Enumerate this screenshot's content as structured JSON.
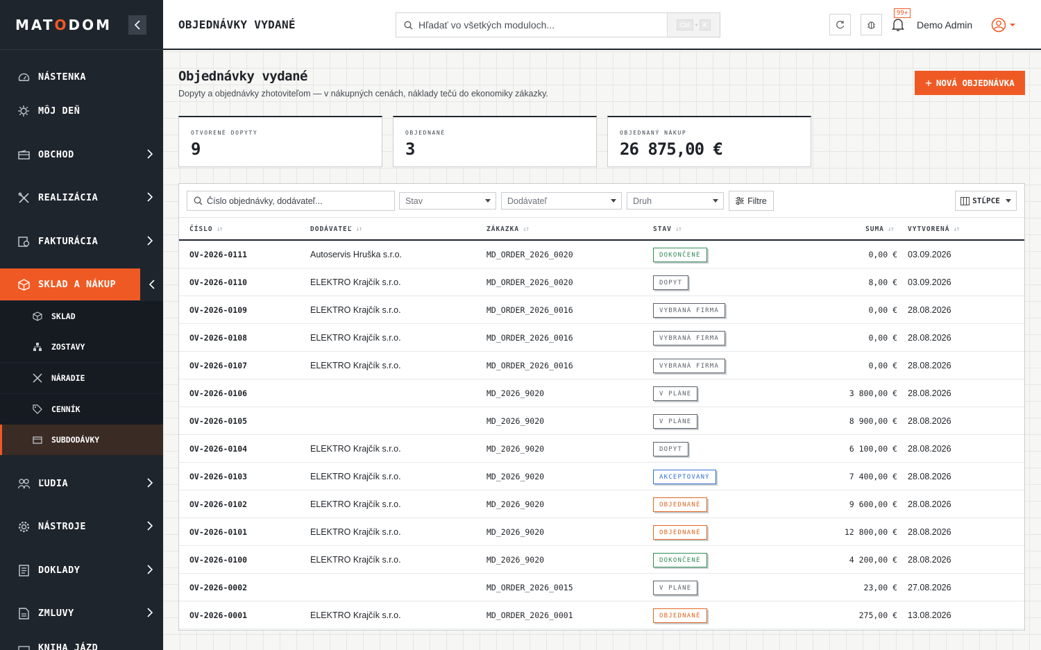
{
  "brand": {
    "logo_part1": "MAT",
    "logo_accent": "O",
    "logo_part2": "DOM",
    "accent_color": "#ef5a24"
  },
  "sidebar": {
    "items": [
      {
        "label": "NÁSTENKA",
        "icon": "gauge-icon"
      },
      {
        "label": "MÔJ DEŇ",
        "icon": "sun-icon"
      },
      {
        "label": "OBCHOD",
        "icon": "wallet-icon"
      },
      {
        "label": "REALIZÁCIA",
        "icon": "tools-icon"
      },
      {
        "label": "FAKTURÁCIA",
        "icon": "invoice-icon"
      },
      {
        "label": "SKLAD A NÁKUP",
        "icon": "box-icon"
      },
      {
        "label": "ĽUDIA",
        "icon": "people-icon"
      },
      {
        "label": "NÁSTROJE",
        "icon": "gear-icon"
      },
      {
        "label": "DOKLADY",
        "icon": "document-icon"
      },
      {
        "label": "ZMLUVY",
        "icon": "contract-icon"
      },
      {
        "label": "KNIHA JÁZD",
        "icon": "car-icon"
      }
    ],
    "subitems": [
      {
        "label": "SKLAD",
        "icon": "box-icon"
      },
      {
        "label": "ZOSTAVY",
        "icon": "hierarchy-icon"
      },
      {
        "label": "NÁRADIE",
        "icon": "tools-icon"
      },
      {
        "label": "CENNÍK",
        "icon": "tag-icon"
      },
      {
        "label": "SUBDODÁVKY",
        "icon": "package-icon"
      }
    ]
  },
  "header": {
    "title": "OBJEDNÁVKY VYDANÉ",
    "search_placeholder": "Hľadať vo všetkých moduloch...",
    "shortcut_key1": "Ctrl",
    "shortcut_key2": "K",
    "notifications_badge": "99+",
    "user_name": "Demo Admin"
  },
  "page": {
    "title": "Objednávky vydané",
    "subtitle": "Dopyty a objednávky zhotoviteľom — v nákupných cenách, náklady tečú do ekonomiky zákazky.",
    "new_button": "NOVÁ OBJEDNÁVKA"
  },
  "stats": [
    {
      "label": "OTVORENÉ DOPYTY",
      "value": "9"
    },
    {
      "label": "OBJEDNANÉ",
      "value": "3"
    },
    {
      "label": "OBJEDNANÝ NÁKUP",
      "value": "26 875,00 €"
    }
  ],
  "filters": {
    "search_placeholder": "Číslo objednávky, dodávateľ...",
    "status_placeholder": "Stav",
    "supplier_placeholder": "Dodávateľ",
    "type_placeholder": "Druh",
    "filters_button": "Filtre",
    "columns_button": "STĹPCE"
  },
  "table": {
    "columns": [
      "ČÍSLO",
      "DODÁVATEĽ",
      "ZÁKAZKA",
      "STAV",
      "SUMA",
      "VYTVORENÁ"
    ],
    "rows": [
      {
        "number": "OV-2026-0111",
        "supplier": "Autoservis Hruška s.r.o.",
        "order": "MD_ORDER_2026_0020",
        "status": "DOKONČENÉ",
        "status_color": "#2e8b57",
        "sum": "0,00 €",
        "created": "03.09.2026"
      },
      {
        "number": "OV-2026-0110",
        "supplier": "ELEKTRO Krajčík s.r.o.",
        "order": "MD_ORDER_2026_0020",
        "status": "DOPYT",
        "status_color": "#5b6169",
        "sum": "8,00 €",
        "created": "03.09.2026"
      },
      {
        "number": "OV-2026-0109",
        "supplier": "ELEKTRO Krajčík s.r.o.",
        "order": "MD_ORDER_2026_0016",
        "status": "VYBRANÁ FIRMA",
        "status_color": "#5b6169",
        "sum": "0,00 €",
        "created": "28.08.2026"
      },
      {
        "number": "OV-2026-0108",
        "supplier": "ELEKTRO Krajčík s.r.o.",
        "order": "MD_ORDER_2026_0016",
        "status": "VYBRANÁ FIRMA",
        "status_color": "#5b6169",
        "sum": "0,00 €",
        "created": "28.08.2026"
      },
      {
        "number": "OV-2026-0107",
        "supplier": "ELEKTRO Krajčík s.r.o.",
        "order": "MD_ORDER_2026_0016",
        "status": "VYBRANÁ FIRMA",
        "status_color": "#5b6169",
        "sum": "0,00 €",
        "created": "28.08.2026"
      },
      {
        "number": "OV-2026-0106",
        "supplier": "",
        "order": "MD_2026_9020",
        "status": "V PLÁNE",
        "status_color": "#5b6169",
        "sum": "3 800,00 €",
        "created": "28.08.2026"
      },
      {
        "number": "OV-2026-0105",
        "supplier": "",
        "order": "MD_2026_9020",
        "status": "V PLÁNE",
        "status_color": "#5b6169",
        "sum": "8 900,00 €",
        "created": "28.08.2026"
      },
      {
        "number": "OV-2026-0104",
        "supplier": "ELEKTRO Krajčík s.r.o.",
        "order": "MD_2026_9020",
        "status": "DOPYT",
        "status_color": "#5b6169",
        "sum": "6 100,00 €",
        "created": "28.08.2026"
      },
      {
        "number": "OV-2026-0103",
        "supplier": "ELEKTRO Krajčík s.r.o.",
        "order": "MD_2026_9020",
        "status": "AKCEPTOVANÝ",
        "status_color": "#2f6fd6",
        "sum": "7 400,00 €",
        "created": "28.08.2026"
      },
      {
        "number": "OV-2026-0102",
        "supplier": "ELEKTRO Krajčík s.r.o.",
        "order": "MD_2026_9020",
        "status": "OBJEDNANÉ",
        "status_color": "#e0661f",
        "sum": "9 600,00 €",
        "created": "28.08.2026"
      },
      {
        "number": "OV-2026-0101",
        "supplier": "ELEKTRO Krajčík s.r.o.",
        "order": "MD_2026_9020",
        "status": "OBJEDNANÉ",
        "status_color": "#e0661f",
        "sum": "12 800,00 €",
        "created": "28.08.2026"
      },
      {
        "number": "OV-2026-0100",
        "supplier": "ELEKTRO Krajčík s.r.o.",
        "order": "MD_2026_9020",
        "status": "DOKONČENÉ",
        "status_color": "#2e8b57",
        "sum": "4 200,00 €",
        "created": "28.08.2026"
      },
      {
        "number": "OV-2026-0002",
        "supplier": "",
        "order": "MD_ORDER_2026_0015",
        "status": "V PLÁNE",
        "status_color": "#5b6169",
        "sum": "23,00 €",
        "created": "27.08.2026"
      },
      {
        "number": "OV-2026-0001",
        "supplier": "ELEKTRO Krajčík s.r.o.",
        "order": "MD_ORDER_2026_0001",
        "status": "OBJEDNANÉ",
        "status_color": "#e0661f",
        "sum": "275,00 €",
        "created": "13.08.2026"
      }
    ]
  }
}
